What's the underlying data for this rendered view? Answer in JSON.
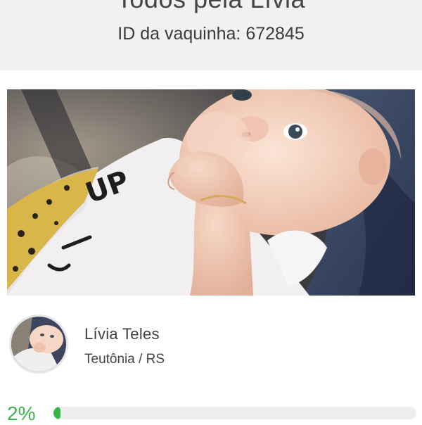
{
  "campaign": {
    "title": "Todos pela Lívia",
    "id_label": "ID da vaquinha: 672845"
  },
  "hero_image": {
    "shirt_text": "UP"
  },
  "organizer": {
    "name": "Lívia Teles",
    "location": "Teutônia / RS"
  },
  "progress": {
    "percent_label": "2%",
    "percent": 2
  },
  "colors": {
    "accent": "#39b54a",
    "top_band": "#f1f1f1"
  }
}
